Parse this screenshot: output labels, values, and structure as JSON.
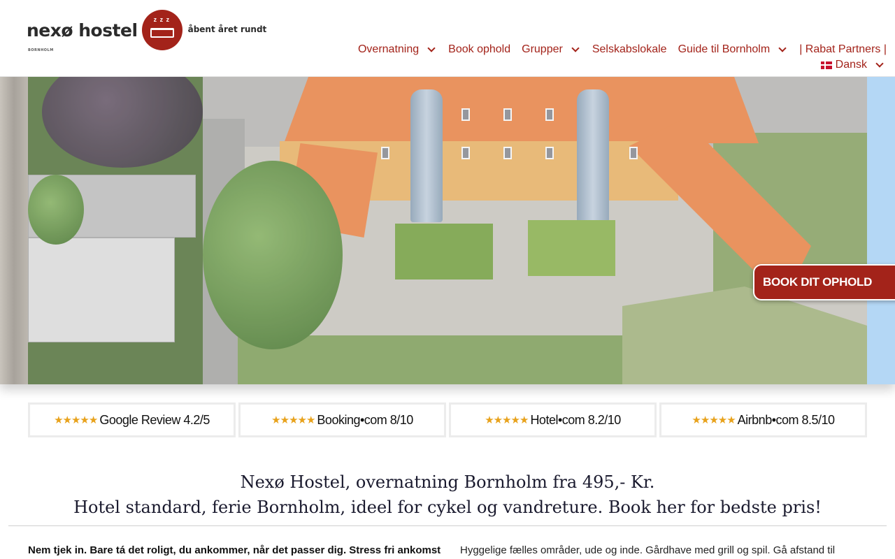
{
  "logo": {
    "name": "nexø hostel",
    "sub": "BORNHOLM",
    "zzz": "z z z",
    "tagline": "åbent året rundt"
  },
  "nav": {
    "items": [
      {
        "label": "Overnatning",
        "dropdown": true
      },
      {
        "label": "Book ophold",
        "dropdown": false
      },
      {
        "label": "Grupper",
        "dropdown": true
      },
      {
        "label": "Selskabslokale",
        "dropdown": false
      },
      {
        "label": "Guide til Bornholm",
        "dropdown": true
      },
      {
        "label": "| Rabat Partners |",
        "dropdown": false
      }
    ],
    "language": "Dansk"
  },
  "hero": {
    "book_button": "BOOK DIT OPHOLD"
  },
  "reviews": [
    {
      "stars": "★★★★★",
      "label": "Google Review 4.2/5"
    },
    {
      "stars": "★★★★★",
      "label": "Booking•com 8/10"
    },
    {
      "stars": "★★★★★",
      "label": "Hotel•com 8.2/10"
    },
    {
      "stars": "★★★★★",
      "label": "Airbnb•com 8.5/10"
    }
  ],
  "content": {
    "heading1": "Nexø Hostel, overnatning Bornholm fra 495,- Kr.",
    "heading2": "Hotel standard, ferie Bornholm, ideel for cykel og vandreture. Book her for bedste pris!",
    "left_text": "Nem tjek in. Bare tá det roligt, du ankommer, når det passer dig. Stress fri ankomst,",
    "right_text": "Hyggelige fælles områder, ude og inde. Gårdhave med grill og spil. Gå afstand til"
  },
  "colors": {
    "brand_red": "#a3231a",
    "star_gold": "#e8a21c"
  }
}
